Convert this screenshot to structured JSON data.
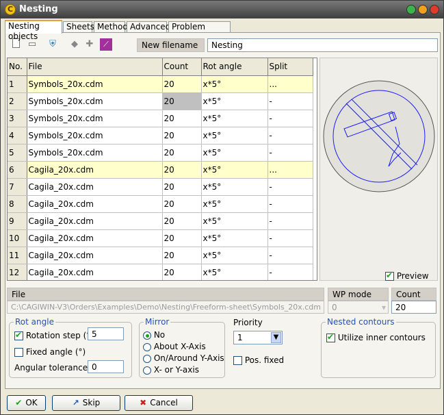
{
  "window": {
    "title": "Nesting",
    "icon_letter": "C"
  },
  "tabs": [
    "Nesting objects",
    "Sheets",
    "Method",
    "Advanced",
    "Problem handling"
  ],
  "toolbar": {
    "new_filename_label": "New filename",
    "new_filename_value": "Nesting"
  },
  "table": {
    "headers": [
      "No.",
      "File",
      "Count",
      "Rot angle",
      "Split"
    ],
    "rows": [
      {
        "no": "1",
        "file": "Symbols_20x.cdm",
        "count": "20",
        "rot": "x*5°",
        "split": "..."
      },
      {
        "no": "2",
        "file": "Symbols_20x.cdm",
        "count": "20",
        "rot": "x*5°",
        "split": "-"
      },
      {
        "no": "3",
        "file": "Symbols_20x.cdm",
        "count": "20",
        "rot": "x*5°",
        "split": "-"
      },
      {
        "no": "4",
        "file": "Symbols_20x.cdm",
        "count": "20",
        "rot": "x*5°",
        "split": "-"
      },
      {
        "no": "5",
        "file": "Symbols_20x.cdm",
        "count": "20",
        "rot": "x*5°",
        "split": "-"
      },
      {
        "no": "6",
        "file": "Cagila_20x.cdm",
        "count": "20",
        "rot": "x*5°",
        "split": "..."
      },
      {
        "no": "7",
        "file": "Cagila_20x.cdm",
        "count": "20",
        "rot": "x*5°",
        "split": "-"
      },
      {
        "no": "8",
        "file": "Cagila_20x.cdm",
        "count": "20",
        "rot": "x*5°",
        "split": "-"
      },
      {
        "no": "9",
        "file": "Cagila_20x.cdm",
        "count": "20",
        "rot": "x*5°",
        "split": "-"
      },
      {
        "no": "10",
        "file": "Cagila_20x.cdm",
        "count": "20",
        "rot": "x*5°",
        "split": "-"
      },
      {
        "no": "11",
        "file": "Cagila_20x.cdm",
        "count": "20",
        "rot": "x*5°",
        "split": "-"
      },
      {
        "no": "12",
        "file": "Cagila_20x.cdm",
        "count": "20",
        "rot": "x*5°",
        "split": "-"
      }
    ]
  },
  "preview": {
    "label": "Preview",
    "checked": true
  },
  "file": {
    "label": "File",
    "value": "C:\\CAGIWIN-V3\\Orders\\Examples\\Demo\\Nesting\\Freeform-sheet\\Symbols_20x.cdm"
  },
  "wp_mode": {
    "label": "WP mode",
    "value": "0"
  },
  "count": {
    "label": "Count",
    "value": "20"
  },
  "rot_angle": {
    "title": "Rot angle",
    "rotation_step_label": "Rotation step (°)",
    "rotation_step_value": "5",
    "fixed_angle_label": "Fixed angle (°)",
    "angular_tolerance_label": "Angular tolerance (°)",
    "angular_tolerance_value": "0"
  },
  "mirror": {
    "title": "Mirror",
    "options": [
      "No",
      "About X-Axis",
      "On/Around Y-Axis",
      "X- or Y-axis"
    ],
    "selected": "No"
  },
  "priority": {
    "label": "Priority",
    "value": "1",
    "pos_fixed_label": "Pos. fixed"
  },
  "nested": {
    "title": "Nested contours",
    "utilize_label": "Utilize inner contours"
  },
  "buttons": {
    "ok": "OK",
    "skip": "Skip",
    "cancel": "Cancel"
  },
  "colors": {
    "accent": "#e6a23a",
    "highlight_row": "#ffffcc",
    "group_title": "#2a4dbd",
    "preview_stroke": "#1a1aff"
  }
}
